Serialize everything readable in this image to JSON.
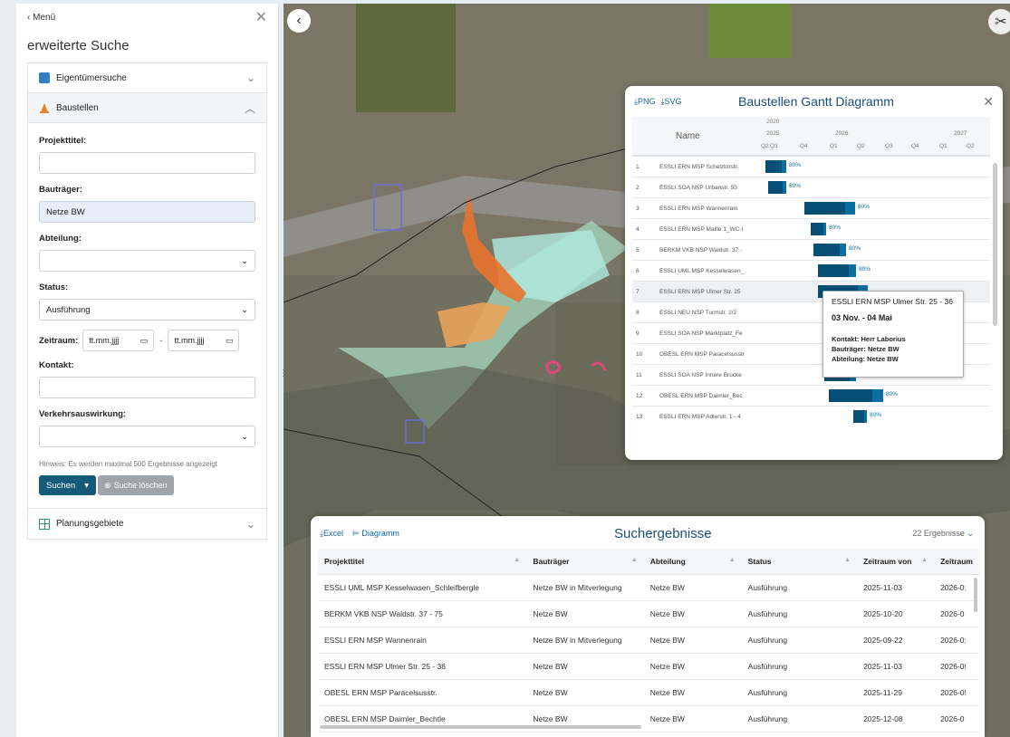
{
  "sidebar": {
    "menu_label": "Menü",
    "title": "erweiterte Suche",
    "sections": {
      "eigentuemer": "Eigentümersuche",
      "baustellen": "Baustellen",
      "planung": "Planungsgebiete"
    },
    "form": {
      "projekttitel_label": "Projekttitel:",
      "projekttitel_value": "",
      "bautraeger_label": "Bauträger:",
      "bautraeger_value": "Netze BW",
      "abteilung_label": "Abteilung:",
      "abteilung_value": "",
      "status_label": "Status:",
      "status_value": "Ausführung",
      "zeitraum_label": "Zeitraum:",
      "date_placeholder": "tt.mm.jjjj",
      "kontakt_label": "Kontakt:",
      "verkehr_label": "Verkehrsauswirkung:",
      "hint": "Hinweis: Es werden maximal 500 Ergebnisse angezeigt",
      "search_btn": "Suchen",
      "clear_btn": "Suche löschen"
    }
  },
  "gantt": {
    "export_png": "PNG",
    "export_svg": "SVG",
    "title": "Baustellen Gantt Diagramm",
    "name_col": "Name",
    "year_group": "2020",
    "years": [
      "2025",
      "2026",
      "2027"
    ],
    "quarters": [
      "Q2",
      "Q3",
      "Q4",
      "Q1",
      "Q2",
      "Q3",
      "Q4",
      "Q1",
      "Q2"
    ],
    "rows": [
      {
        "n": "1",
        "name": "ESSLI ERN MSP Schelztorstr.",
        "pct": "80%"
      },
      {
        "n": "2",
        "name": "ESSLI SOA NSP Urbanstr. 55",
        "pct": "80%"
      },
      {
        "n": "3",
        "name": "ESSLI ERN MSP Wannenrain",
        "pct": "80%"
      },
      {
        "n": "4",
        "name": "ESSLI ERN MSP Maille 1_WC-I",
        "pct": "80%"
      },
      {
        "n": "5",
        "name": "BERKM VKB NSP Waldstr. 37 -",
        "pct": "80%"
      },
      {
        "n": "6",
        "name": "ESSLI UML MSP Kesselwasen_",
        "pct": "80%"
      },
      {
        "n": "7",
        "name": "ESSLI ERN MSP Ulmer Str. 25",
        "pct": ""
      },
      {
        "n": "8",
        "name": "ESSLI NEU NSP Turmstr. 2/2",
        "pct": ""
      },
      {
        "n": "9",
        "name": "ESSLI SOA NSP Marktplatz_Fe",
        "pct": ""
      },
      {
        "n": "10",
        "name": "OBESL ERN MSP Paracelsusstr",
        "pct": ""
      },
      {
        "n": "11",
        "name": "ESSLI SOA NSP Innere Brücke",
        "pct": "80%"
      },
      {
        "n": "12",
        "name": "OBESL ERN MSP Daimler_Bec",
        "pct": "80%"
      },
      {
        "n": "13",
        "name": "ESSLI ERN MSP Adlerstr. 1 - 4",
        "pct": "80%"
      }
    ],
    "tooltip": {
      "title": "ESSLI ERN MSP Ulmer Str. 25 - 36",
      "range": "03 Nov. - 04 Mai",
      "kontakt": "Kontakt: Herr Laborius",
      "bautraeger": "Bauträger: Netze BW",
      "abteilung": "Abteilung: Netze BW"
    }
  },
  "results": {
    "export_excel": "Excel",
    "export_diagram": "Diagramm",
    "title": "Suchergebnisse",
    "count": "22 Ergebnisse",
    "columns": [
      "Projekttitel",
      "Bauträger",
      "Abteilung",
      "Status",
      "Zeitraum von",
      "Zeitraum"
    ],
    "rows": [
      [
        "ESSLI UML MSP Kesselwasen_Schleifbergle",
        "Netze BW in Mitverlegung",
        "Netze BW",
        "Ausführung",
        "2025-11-03",
        "2026-0:"
      ],
      [
        "BERKM VKB NSP Waldstr. 37 - 75",
        "Netze BW",
        "Netze BW",
        "Ausführung",
        "2025-10-20",
        "2026-0"
      ],
      [
        "ESSLI ERN MSP Wannenrain",
        "Netze BW in Mitverlegung",
        "Netze BW",
        "Ausführung",
        "2025-09-22",
        "2026-0:"
      ],
      [
        "ESSLI ERN MSP Ulmer Str. 25 - 36",
        "Netze BW",
        "Netze BW",
        "Ausführung",
        "2025-11-03",
        "2026-0!"
      ],
      [
        "OBESL ERN MSP Paracelsusstr.",
        "Netze BW",
        "Netze BW",
        "Ausführung",
        "2025-11-29",
        "2026-0!"
      ],
      [
        "OBESL ERN MSP Daimler_Bechtle",
        "Netze BW",
        "Netze BW",
        "Ausführung",
        "2025-12-08",
        "2026-0"
      ]
    ]
  }
}
